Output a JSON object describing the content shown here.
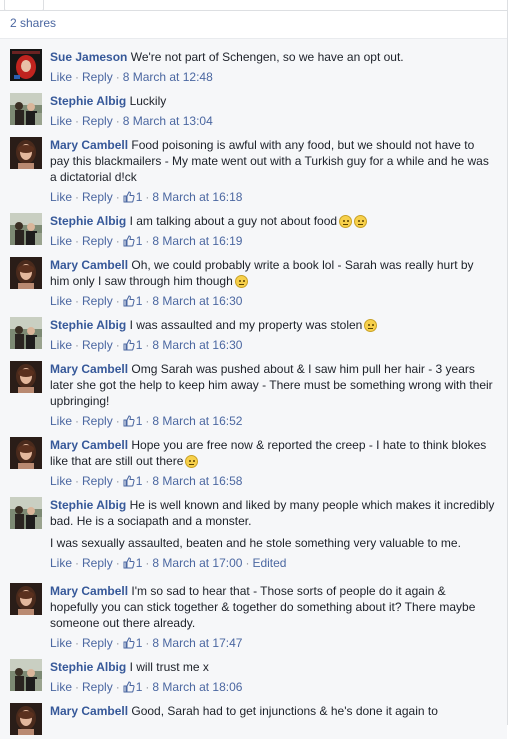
{
  "shares_label": "2 shares",
  "action_labels": {
    "like": "Like",
    "reply": "Reply",
    "sep": "·",
    "edited": "Edited"
  },
  "comments": [
    {
      "author": "Sue Jameson",
      "text": "We're not part of Schengen, so we have an opt out.",
      "likes": "",
      "time": "8 March at 12:48",
      "avatar": "red-hair-icon"
    },
    {
      "author": "Stephie Albig",
      "text": "Luckily",
      "likes": "",
      "time": "8 March at 13:04",
      "avatar": "group-photo-icon"
    },
    {
      "author": "Mary Cambell",
      "text": "Food poisoning is awful with any food, but we should not have to pay this blackmailers - My mate went out with a Turkish guy for a while and he was a dictatorial d!ck",
      "likes": "1",
      "time": "8 March at 16:18",
      "avatar": "woman-portrait-icon"
    },
    {
      "author": "Stephie Albig",
      "text": "I am talking about a guy not about food",
      "emoji": 2,
      "likes": "1",
      "time": "8 March at 16:19",
      "avatar": "group-photo-icon"
    },
    {
      "author": "Mary Cambell",
      "text": "Oh, we could probably write a book lol - Sarah was really hurt by him only I saw through him though",
      "emoji": 1,
      "likes": "1",
      "time": "8 March at 16:30",
      "avatar": "woman-portrait-icon"
    },
    {
      "author": "Stephie Albig",
      "text": "I was assaulted and my property was stolen",
      "emoji": 1,
      "likes": "1",
      "time": "8 March at 16:30",
      "avatar": "group-photo-icon"
    },
    {
      "author": "Mary Cambell",
      "text": "Omg Sarah was pushed about & I saw him pull her hair - 3 years later she got the help to keep him away - There must be something wrong with their upbringing!",
      "likes": "1",
      "time": "8 March at 16:52",
      "avatar": "woman-portrait-icon"
    },
    {
      "author": "Mary Cambell",
      "text": "Hope you are free now & reported the creep - I hate to think blokes like that are still out there",
      "emoji": 1,
      "likes": "1",
      "time": "8 March at 16:58",
      "avatar": "woman-portrait-icon"
    },
    {
      "author": "Stephie Albig",
      "text": "He is well known and liked by many people which makes it incredibly bad. He is a sociapath and a monster.",
      "extra": "I was sexually assaulted, beaten and he stole something very valuable to me.",
      "likes": "1",
      "time": "8 March at 17:00",
      "edited": true,
      "avatar": "group-photo-icon"
    },
    {
      "author": "Mary Cambell",
      "text": "I'm so sad to hear that - Those sorts of people do it again & hopefully you can stick together & together do something about it? There maybe someone out there already.",
      "likes": "1",
      "time": "8 March at 17:47",
      "avatar": "woman-portrait-icon"
    },
    {
      "author": "Stephie Albig",
      "text": "I will trust me x",
      "likes": "1",
      "time": "8 March at 18:06",
      "avatar": "group-photo-icon"
    },
    {
      "author": "Mary Cambell",
      "text": "Good, Sarah had to get injunctions & he's done it again to",
      "likes": "",
      "time": "",
      "avatar": "woman-portrait-icon"
    }
  ]
}
